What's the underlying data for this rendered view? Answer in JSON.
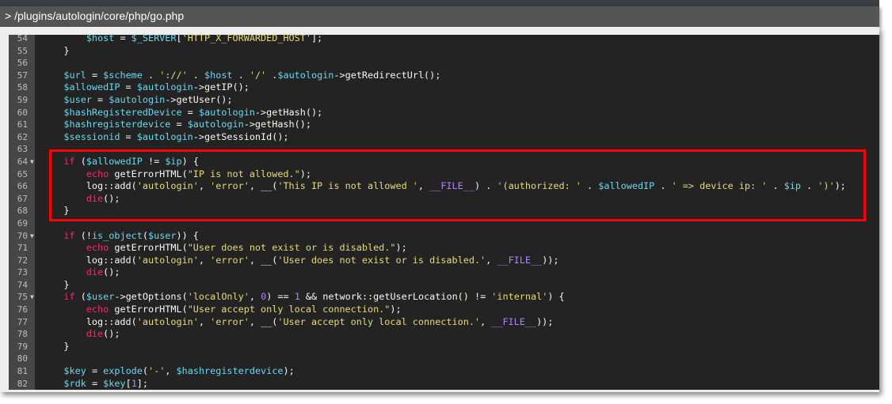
{
  "header": {
    "path": "> /plugins/autologin/core/php/go.php"
  },
  "colors": {
    "keyword": "#f92672",
    "variable": "#66d9ef",
    "string": "#e6db74",
    "constant": "#ae81ff",
    "plain": "#f8f8f2",
    "highlight": "#ff0000"
  },
  "highlight": {
    "from_line": 64,
    "to_line": 68
  },
  "code_lines": [
    {
      "n": "54",
      "fold": false,
      "tokens": [
        [
          "plain",
          "        "
        ],
        [
          "var",
          "$host"
        ],
        [
          "plain",
          " = "
        ],
        [
          "var",
          "$_SERVER"
        ],
        [
          "plain",
          "["
        ],
        [
          "str",
          "'HTTP_X_FORWARDED_HOST'"
        ],
        [
          "plain",
          "];"
        ]
      ]
    },
    {
      "n": "55",
      "fold": false,
      "tokens": [
        [
          "plain",
          "    }"
        ]
      ]
    },
    {
      "n": "56",
      "fold": false,
      "tokens": []
    },
    {
      "n": "57",
      "fold": false,
      "tokens": [
        [
          "plain",
          "    "
        ],
        [
          "var",
          "$url"
        ],
        [
          "plain",
          " = "
        ],
        [
          "var",
          "$scheme"
        ],
        [
          "plain",
          " . "
        ],
        [
          "str",
          "'://'"
        ],
        [
          "plain",
          " . "
        ],
        [
          "var",
          "$host"
        ],
        [
          "plain",
          " . "
        ],
        [
          "str",
          "'/'"
        ],
        [
          "plain",
          " ."
        ],
        [
          "var",
          "$autologin"
        ],
        [
          "plain",
          "->getRedirectUrl();"
        ]
      ]
    },
    {
      "n": "58",
      "fold": false,
      "tokens": [
        [
          "plain",
          "    "
        ],
        [
          "var",
          "$allowedIP"
        ],
        [
          "plain",
          " = "
        ],
        [
          "var",
          "$autologin"
        ],
        [
          "plain",
          "->getIP();"
        ]
      ]
    },
    {
      "n": "59",
      "fold": false,
      "tokens": [
        [
          "plain",
          "    "
        ],
        [
          "var",
          "$user"
        ],
        [
          "plain",
          " = "
        ],
        [
          "var",
          "$autologin"
        ],
        [
          "plain",
          "->getUser();"
        ]
      ]
    },
    {
      "n": "60",
      "fold": false,
      "tokens": [
        [
          "plain",
          "    "
        ],
        [
          "var",
          "$hashRegisteredDevice"
        ],
        [
          "plain",
          " = "
        ],
        [
          "var",
          "$autologin"
        ],
        [
          "plain",
          "->getHash();"
        ]
      ]
    },
    {
      "n": "61",
      "fold": false,
      "tokens": [
        [
          "plain",
          "    "
        ],
        [
          "var",
          "$hashregisterdevice"
        ],
        [
          "plain",
          " = "
        ],
        [
          "var",
          "$autologin"
        ],
        [
          "plain",
          "->getHash();"
        ]
      ]
    },
    {
      "n": "62",
      "fold": false,
      "tokens": [
        [
          "plain",
          "    "
        ],
        [
          "var",
          "$sessionid"
        ],
        [
          "plain",
          " = "
        ],
        [
          "var",
          "$autologin"
        ],
        [
          "plain",
          "->getSessionId();"
        ]
      ]
    },
    {
      "n": "63",
      "fold": false,
      "tokens": []
    },
    {
      "n": "64",
      "fold": true,
      "tokens": [
        [
          "plain",
          "    "
        ],
        [
          "kw",
          "if"
        ],
        [
          "plain",
          " ("
        ],
        [
          "var",
          "$allowedIP"
        ],
        [
          "plain",
          " != "
        ],
        [
          "var",
          "$ip"
        ],
        [
          "plain",
          ") {"
        ]
      ]
    },
    {
      "n": "65",
      "fold": false,
      "tokens": [
        [
          "plain",
          "        "
        ],
        [
          "kw",
          "echo"
        ],
        [
          "plain",
          " getErrorHTML("
        ],
        [
          "str",
          "\"IP is not allowed.\""
        ],
        [
          "plain",
          ");"
        ]
      ]
    },
    {
      "n": "66",
      "fold": false,
      "tokens": [
        [
          "plain",
          "        log::add("
        ],
        [
          "str",
          "'autologin'"
        ],
        [
          "plain",
          ", "
        ],
        [
          "str",
          "'error'"
        ],
        [
          "plain",
          ", __("
        ],
        [
          "str",
          "'This IP is not allowed '"
        ],
        [
          "plain",
          ", "
        ],
        [
          "num",
          "__FILE__"
        ],
        [
          "plain",
          ") . "
        ],
        [
          "str",
          "'(authorized: '"
        ],
        [
          "plain",
          " . "
        ],
        [
          "var",
          "$allowedIP"
        ],
        [
          "plain",
          " . "
        ],
        [
          "str",
          "' => device ip: '"
        ],
        [
          "plain",
          " . "
        ],
        [
          "var",
          "$ip"
        ],
        [
          "plain",
          " . "
        ],
        [
          "str",
          "')'"
        ],
        [
          "plain",
          ");"
        ]
      ]
    },
    {
      "n": "67",
      "fold": false,
      "tokens": [
        [
          "plain",
          "        "
        ],
        [
          "kw",
          "die"
        ],
        [
          "plain",
          "();"
        ]
      ]
    },
    {
      "n": "68",
      "fold": false,
      "tokens": [
        [
          "plain",
          "    }"
        ]
      ]
    },
    {
      "n": "69",
      "fold": false,
      "tokens": []
    },
    {
      "n": "70",
      "fold": true,
      "tokens": [
        [
          "plain",
          "    "
        ],
        [
          "kw",
          "if"
        ],
        [
          "plain",
          " (!"
        ],
        [
          "var",
          "is_object"
        ],
        [
          "plain",
          "("
        ],
        [
          "var",
          "$user"
        ],
        [
          "plain",
          ")) {"
        ]
      ]
    },
    {
      "n": "71",
      "fold": false,
      "tokens": [
        [
          "plain",
          "        "
        ],
        [
          "kw",
          "echo"
        ],
        [
          "plain",
          " getErrorHTML("
        ],
        [
          "str",
          "\"User does not exist or is disabled.\""
        ],
        [
          "plain",
          ");"
        ]
      ]
    },
    {
      "n": "72",
      "fold": false,
      "tokens": [
        [
          "plain",
          "        log::add("
        ],
        [
          "str",
          "'autologin'"
        ],
        [
          "plain",
          ", "
        ],
        [
          "str",
          "'error'"
        ],
        [
          "plain",
          ", __("
        ],
        [
          "str",
          "'User does not exist or is disabled.'"
        ],
        [
          "plain",
          ", "
        ],
        [
          "num",
          "__FILE__"
        ],
        [
          "plain",
          "));"
        ]
      ]
    },
    {
      "n": "73",
      "fold": false,
      "tokens": [
        [
          "plain",
          "        "
        ],
        [
          "kw",
          "die"
        ],
        [
          "plain",
          "();"
        ]
      ]
    },
    {
      "n": "74",
      "fold": false,
      "tokens": [
        [
          "plain",
          "    }"
        ]
      ]
    },
    {
      "n": "75",
      "fold": true,
      "tokens": [
        [
          "plain",
          "    "
        ],
        [
          "kw",
          "if"
        ],
        [
          "plain",
          " ("
        ],
        [
          "var",
          "$user"
        ],
        [
          "plain",
          "->getOptions("
        ],
        [
          "str",
          "'localOnly'"
        ],
        [
          "plain",
          ", "
        ],
        [
          "num",
          "0"
        ],
        [
          "plain",
          ") == "
        ],
        [
          "num",
          "1"
        ],
        [
          "plain",
          " && network::getUserLocation() != "
        ],
        [
          "str",
          "'internal'"
        ],
        [
          "plain",
          ") {"
        ]
      ]
    },
    {
      "n": "76",
      "fold": false,
      "tokens": [
        [
          "plain",
          "        "
        ],
        [
          "kw",
          "echo"
        ],
        [
          "plain",
          " getErrorHTML("
        ],
        [
          "str",
          "\"User accept only local connection.\""
        ],
        [
          "plain",
          ");"
        ]
      ]
    },
    {
      "n": "77",
      "fold": false,
      "tokens": [
        [
          "plain",
          "        log::add("
        ],
        [
          "str",
          "'autologin'"
        ],
        [
          "plain",
          ", "
        ],
        [
          "str",
          "'error'"
        ],
        [
          "plain",
          ", __("
        ],
        [
          "str",
          "'User accept only local connection.'"
        ],
        [
          "plain",
          ", "
        ],
        [
          "num",
          "__FILE__"
        ],
        [
          "plain",
          "));"
        ]
      ]
    },
    {
      "n": "78",
      "fold": false,
      "tokens": [
        [
          "plain",
          "        "
        ],
        [
          "kw",
          "die"
        ],
        [
          "plain",
          "();"
        ]
      ]
    },
    {
      "n": "79",
      "fold": false,
      "tokens": [
        [
          "plain",
          "    }"
        ]
      ]
    },
    {
      "n": "80",
      "fold": false,
      "tokens": []
    },
    {
      "n": "81",
      "fold": false,
      "tokens": [
        [
          "plain",
          "    "
        ],
        [
          "var",
          "$key"
        ],
        [
          "plain",
          " = "
        ],
        [
          "var",
          "explode"
        ],
        [
          "plain",
          "("
        ],
        [
          "str",
          "'-'"
        ],
        [
          "plain",
          ", "
        ],
        [
          "var",
          "$hashregisterdevice"
        ],
        [
          "plain",
          ");"
        ]
      ]
    },
    {
      "n": "82",
      "fold": false,
      "tokens": [
        [
          "plain",
          "    "
        ],
        [
          "var",
          "$rdk"
        ],
        [
          "plain",
          " = "
        ],
        [
          "var",
          "$key"
        ],
        [
          "plain",
          "["
        ],
        [
          "num",
          "1"
        ],
        [
          "plain",
          "];"
        ]
      ]
    }
  ]
}
